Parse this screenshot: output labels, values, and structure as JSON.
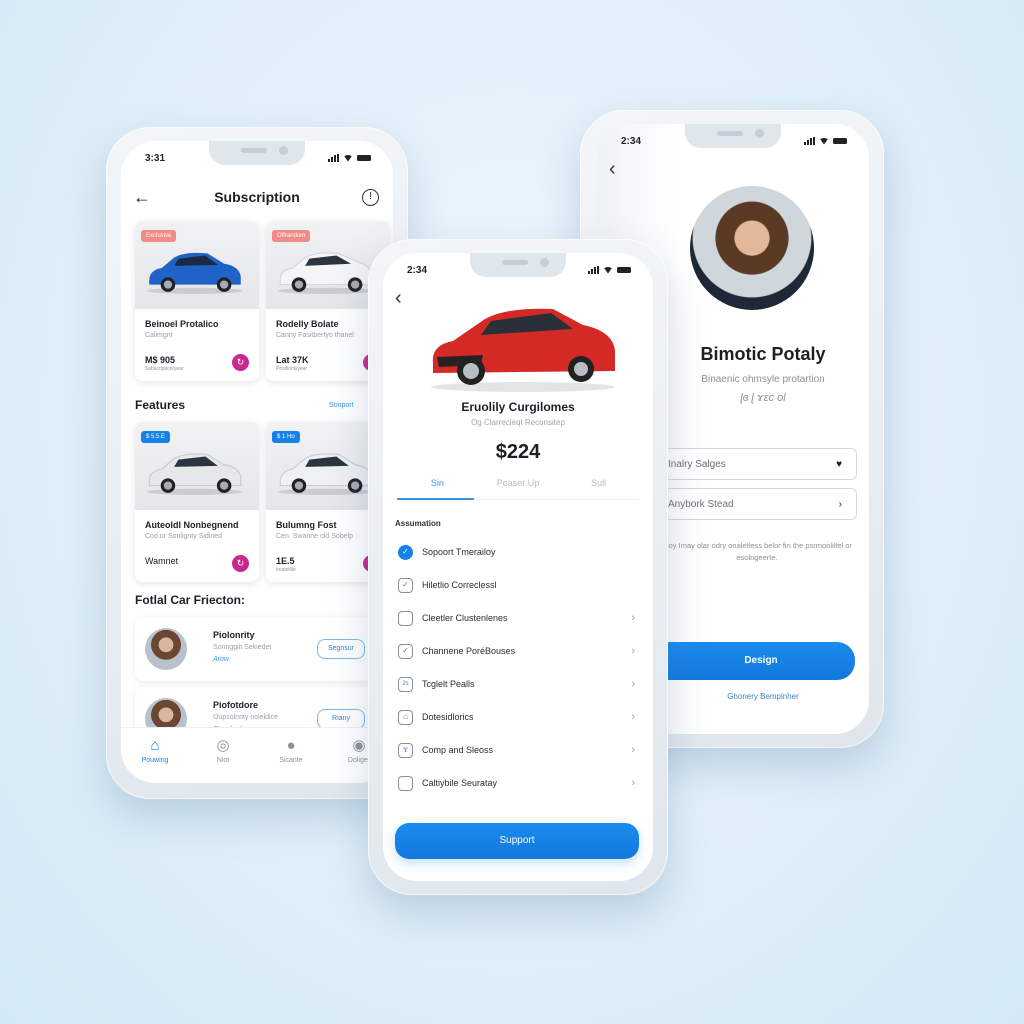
{
  "left_screen": {
    "status_time": "3:31",
    "header": {
      "title": "Subscription",
      "back_icon": "arrow-left-icon",
      "action_icon": "info-icon"
    },
    "subscription_cards": [
      {
        "tag": "Exclusive",
        "name": "Beinoel Protalico",
        "subtitle": "Calimgnt",
        "price": "M$ 905",
        "price_note": "Subscription/year",
        "image": "blue-sedan",
        "tag_color": "#f28a86"
      },
      {
        "tag": "Offrandum",
        "name": "Rodelly Bolate",
        "subtitle": "Canny Fositbertyo thanel",
        "price": "Lat 37K",
        "price_note": "Positionlyyear",
        "image": "white-hatchback",
        "tag_color": "#f28a86"
      }
    ],
    "features": {
      "title": "Features",
      "link": "Sonport",
      "cards": [
        {
          "tag": "$ 5.5.E",
          "name": "Auteoldl Nonbegnend",
          "subtitle": "Cod or Sonlignty Sidined",
          "price": "Wamnet",
          "price_note": "",
          "image": "silver-sedan",
          "tag_color": "#1782e6"
        },
        {
          "tag": "$ 1 Ho",
          "name": "Bulumng Fost",
          "subtitle": "Cen. Swanne old Sobelp",
          "price": "1E.5",
          "price_note": "Imaletille",
          "image": "white-sedan",
          "tag_color": "#1782e6"
        }
      ]
    },
    "people_section": {
      "title": "Fotlal Car Friecton:",
      "people": [
        {
          "name": "Piolonrity",
          "description": "Sonnggiit Sekiedet",
          "tag": "Arow",
          "button": "Segnsur"
        },
        {
          "name": "Piofotdore",
          "description": "Oupsolnrity noleldice",
          "tag": "Standard",
          "button": "Riany"
        }
      ]
    },
    "tabbar": [
      {
        "label": "Pouwing",
        "icon": "home-icon",
        "active": true
      },
      {
        "label": "Niot",
        "icon": "location-icon",
        "active": false
      },
      {
        "label": "Sicante",
        "icon": "user-icon",
        "active": false
      },
      {
        "label": "Doliger",
        "icon": "settings-icon",
        "active": false
      }
    ]
  },
  "middle_screen": {
    "status_time": "2:34",
    "back_icon": "chevron-left-icon",
    "product": {
      "title": "Eruolily Curgilomes",
      "subtitle": "Og Clarrecleqt Reconsitep",
      "price": "$224",
      "image": "red-sedan"
    },
    "tabs": [
      {
        "label": "Sin",
        "active": true
      },
      {
        "label": "Poaser Up",
        "active": false
      },
      {
        "label": "Sull",
        "active": false
      }
    ],
    "list_heading": "Assumation",
    "options": [
      {
        "label": "Sopoort Tmerailoy",
        "state": "checked-filled",
        "mark": "✓",
        "chevron": false
      },
      {
        "label": "Hiletlio Correclessl",
        "state": "checked",
        "mark": "✓",
        "chevron": false
      },
      {
        "label": "Cleetler Clustenlenes",
        "state": "unchecked",
        "mark": "",
        "chevron": true
      },
      {
        "label": "Channene PoréBouses",
        "state": "checked",
        "mark": "✓",
        "chevron": true
      },
      {
        "label": "Tcglelt Pealls",
        "state": "icon",
        "mark": "2s",
        "chevron": true
      },
      {
        "label": "Dotesidlorics",
        "state": "icon",
        "mark": "⌂",
        "chevron": true
      },
      {
        "label": "Comp and Sleoss",
        "state": "icon",
        "mark": "ɤ",
        "chevron": true
      },
      {
        "label": "Caltiybile Seuratay",
        "state": "unchecked",
        "mark": "",
        "chevron": true
      }
    ],
    "cta": "Support"
  },
  "right_screen": {
    "status_time": "2:34",
    "back_icon": "chevron-left-icon",
    "profile": {
      "name": "Bimotic Potaly",
      "subtitle": "Binaenic ohmsyle protartion",
      "signature": "ɭɞ ɭ ɤɛc ol"
    },
    "fields": [
      {
        "value": "Inalry Salges",
        "icon": "heart-icon",
        "glyph": "♥"
      },
      {
        "value": "Anybork Stead",
        "icon": "arrow-right-icon",
        "glyph": "›"
      }
    ],
    "note": "Bioy Imay olar odry onaletless belor fin the psrmonliltel or esolngeerte.",
    "primary_button": "Design",
    "link": "Ghonery Bemplnher"
  },
  "colors": {
    "accent": "#1782e6",
    "badge_red": "#f28a86",
    "fav_magenta": "#c9288f",
    "background": "#e0eff9"
  }
}
